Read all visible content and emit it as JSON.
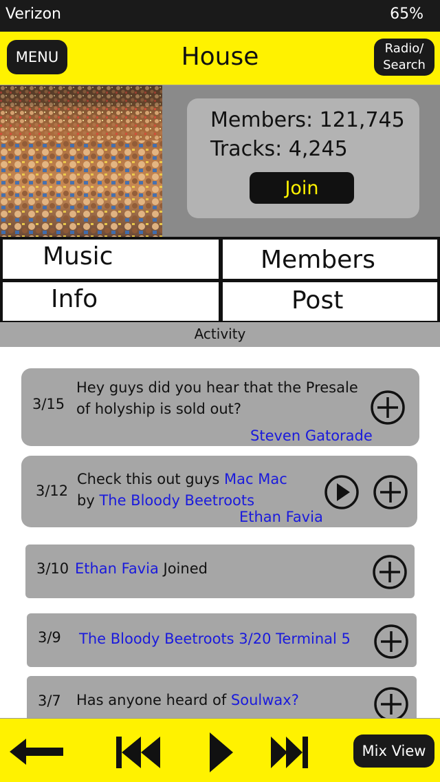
{
  "status": {
    "carrier": "Verizon",
    "battery": "65%"
  },
  "header": {
    "menu_label": "MENU",
    "title": "House",
    "radio_line1": "Radio/",
    "radio_line2": "Search"
  },
  "group": {
    "members": "Members: 121,745",
    "tracks": "Tracks: 4,245",
    "join_label": "Join"
  },
  "nav": {
    "music": "Music",
    "members": "Members",
    "info": "Info",
    "post": "Post"
  },
  "activity_label": "Activity",
  "activity": [
    {
      "date": "3/15",
      "line1": "Hey guys did you hear that the Presale",
      "line2": "of holyship is sold out?",
      "author": "Steven Gatorade"
    },
    {
      "date": "3/12",
      "pre": "Check this out guys ",
      "track": "Mac Mac",
      "by": "by ",
      "artist": "The Bloody Beetroots",
      "author": "Ethan Favia"
    },
    {
      "date": "3/10",
      "user": "Ethan Favia",
      "action": " Joined"
    },
    {
      "date": "3/9",
      "event": "The Bloody Beetroots 3/20 Terminal 5"
    },
    {
      "date": "3/7",
      "pre": "Has anyone heard of ",
      "artist": "Soulwax?"
    }
  ],
  "player": {
    "mix_label": "Mix View"
  },
  "icons": {
    "back": "back-arrow-icon",
    "previous": "previous-track-icon",
    "play": "play-icon",
    "next": "next-track-icon",
    "add": "plus-circle-icon",
    "play_circle": "play-circle-icon"
  },
  "colors": {
    "accent": "#fff200",
    "link": "#1a1adc",
    "card": "#a6a6a6",
    "dark": "#1a1a1a"
  }
}
